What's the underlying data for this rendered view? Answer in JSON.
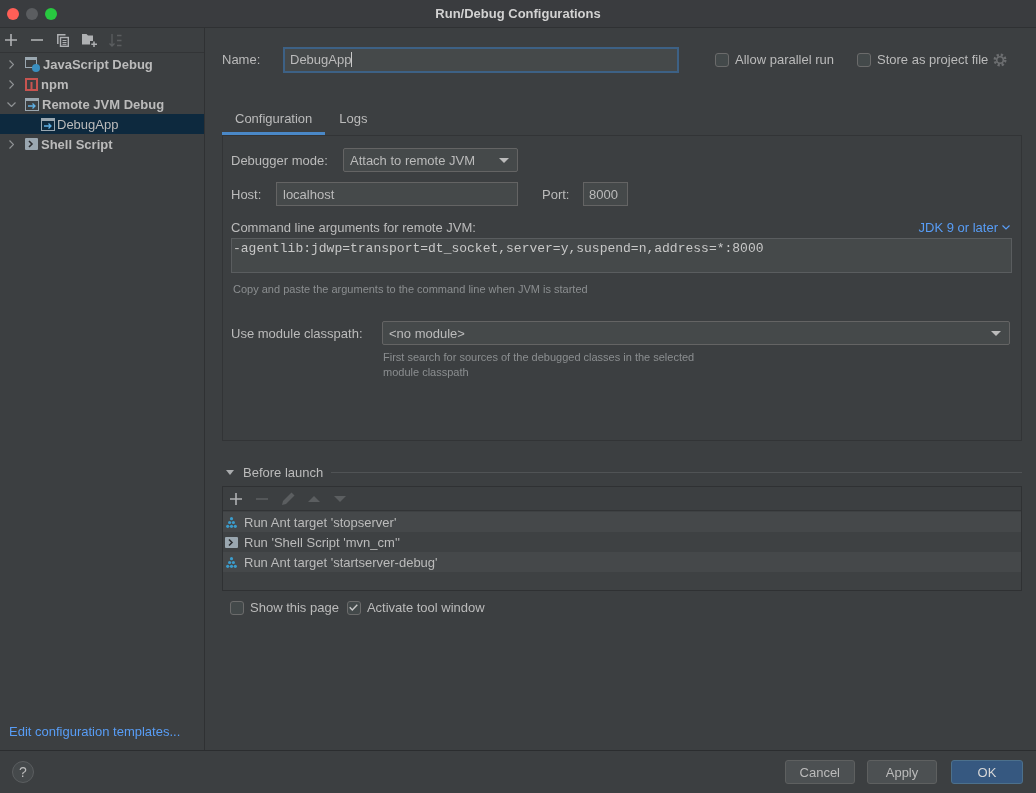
{
  "window": {
    "title": "Run/Debug Configurations",
    "controls": [
      {
        "kind": "close",
        "disabled": false
      },
      {
        "kind": "minimize",
        "disabled": true
      },
      {
        "kind": "zoom",
        "disabled": false
      }
    ]
  },
  "sidebar": {
    "toolbar": [
      {
        "kind": "add",
        "disabled": false
      },
      {
        "kind": "remove",
        "disabled": false
      },
      {
        "kind": "copy",
        "disabled": false
      },
      {
        "kind": "new-folder",
        "disabled": false
      },
      {
        "kind": "sort",
        "disabled": true
      }
    ],
    "tree": [
      {
        "label": "JavaScript Debug",
        "kind": "javascript-debug",
        "expanded": false,
        "selected": false
      },
      {
        "label": "npm",
        "kind": "npm",
        "expanded": false,
        "selected": false
      },
      {
        "label": "Remote JVM Debug",
        "kind": "remote-debug",
        "expanded": true,
        "selected": false,
        "children": [
          {
            "label": "DebugApp",
            "kind": "remote-debug",
            "selected": true
          }
        ]
      },
      {
        "label": "Shell Script",
        "kind": "shell-script",
        "expanded": false,
        "selected": false
      }
    ],
    "templates_link": "Edit configuration templates..."
  },
  "name": {
    "label": "Name:",
    "value": "DebugApp",
    "focused": true
  },
  "allow_parallel_run": {
    "label": "Allow parallel run",
    "checked": false
  },
  "store_as_project_file": {
    "label": "Store as project file",
    "checked": false
  },
  "tabs": [
    {
      "label": "Configuration",
      "selected": true
    },
    {
      "label": "Logs",
      "selected": false
    }
  ],
  "configuration": {
    "debugger_mode": {
      "label": "Debugger mode:",
      "value": "Attach to remote JVM"
    },
    "host": {
      "label": "Host:",
      "value": "localhost"
    },
    "port": {
      "label": "Port:",
      "value": "8000"
    },
    "command_line": {
      "label": "Command line arguments for remote JVM:",
      "jdk_selector": "JDK 9 or later",
      "value": "-agentlib:jdwp=transport=dt_socket,server=y,suspend=n,address=*:8000",
      "hint": "Copy and paste the arguments to the command line when JVM is started"
    },
    "module_classpath": {
      "label": "Use module classpath:",
      "value": "<no module>",
      "hint": "First search for sources of the debugged classes in the selected module classpath"
    }
  },
  "before_launch": {
    "title": "Before launch",
    "expanded": true,
    "toolbar": [
      {
        "kind": "add",
        "disabled": false
      },
      {
        "kind": "remove",
        "disabled": true
      },
      {
        "kind": "edit",
        "disabled": true
      },
      {
        "kind": "up",
        "disabled": true
      },
      {
        "kind": "down",
        "disabled": true
      }
    ],
    "tasks": [
      {
        "kind": "ant",
        "label": "Run Ant target 'stopserver'"
      },
      {
        "kind": "shell",
        "label": "Run 'Shell Script 'mvn_cm''"
      },
      {
        "kind": "ant",
        "label": "Run Ant target 'startserver-debug'"
      }
    ],
    "options": [
      {
        "label": "Show this page",
        "checked": false
      },
      {
        "label": "Activate tool window",
        "checked": true
      }
    ]
  },
  "footer": {
    "help": "?",
    "buttons": [
      {
        "label": "Cancel",
        "kind": "default"
      },
      {
        "label": "Apply",
        "kind": "default"
      },
      {
        "label": "OK",
        "kind": "primary"
      }
    ]
  }
}
